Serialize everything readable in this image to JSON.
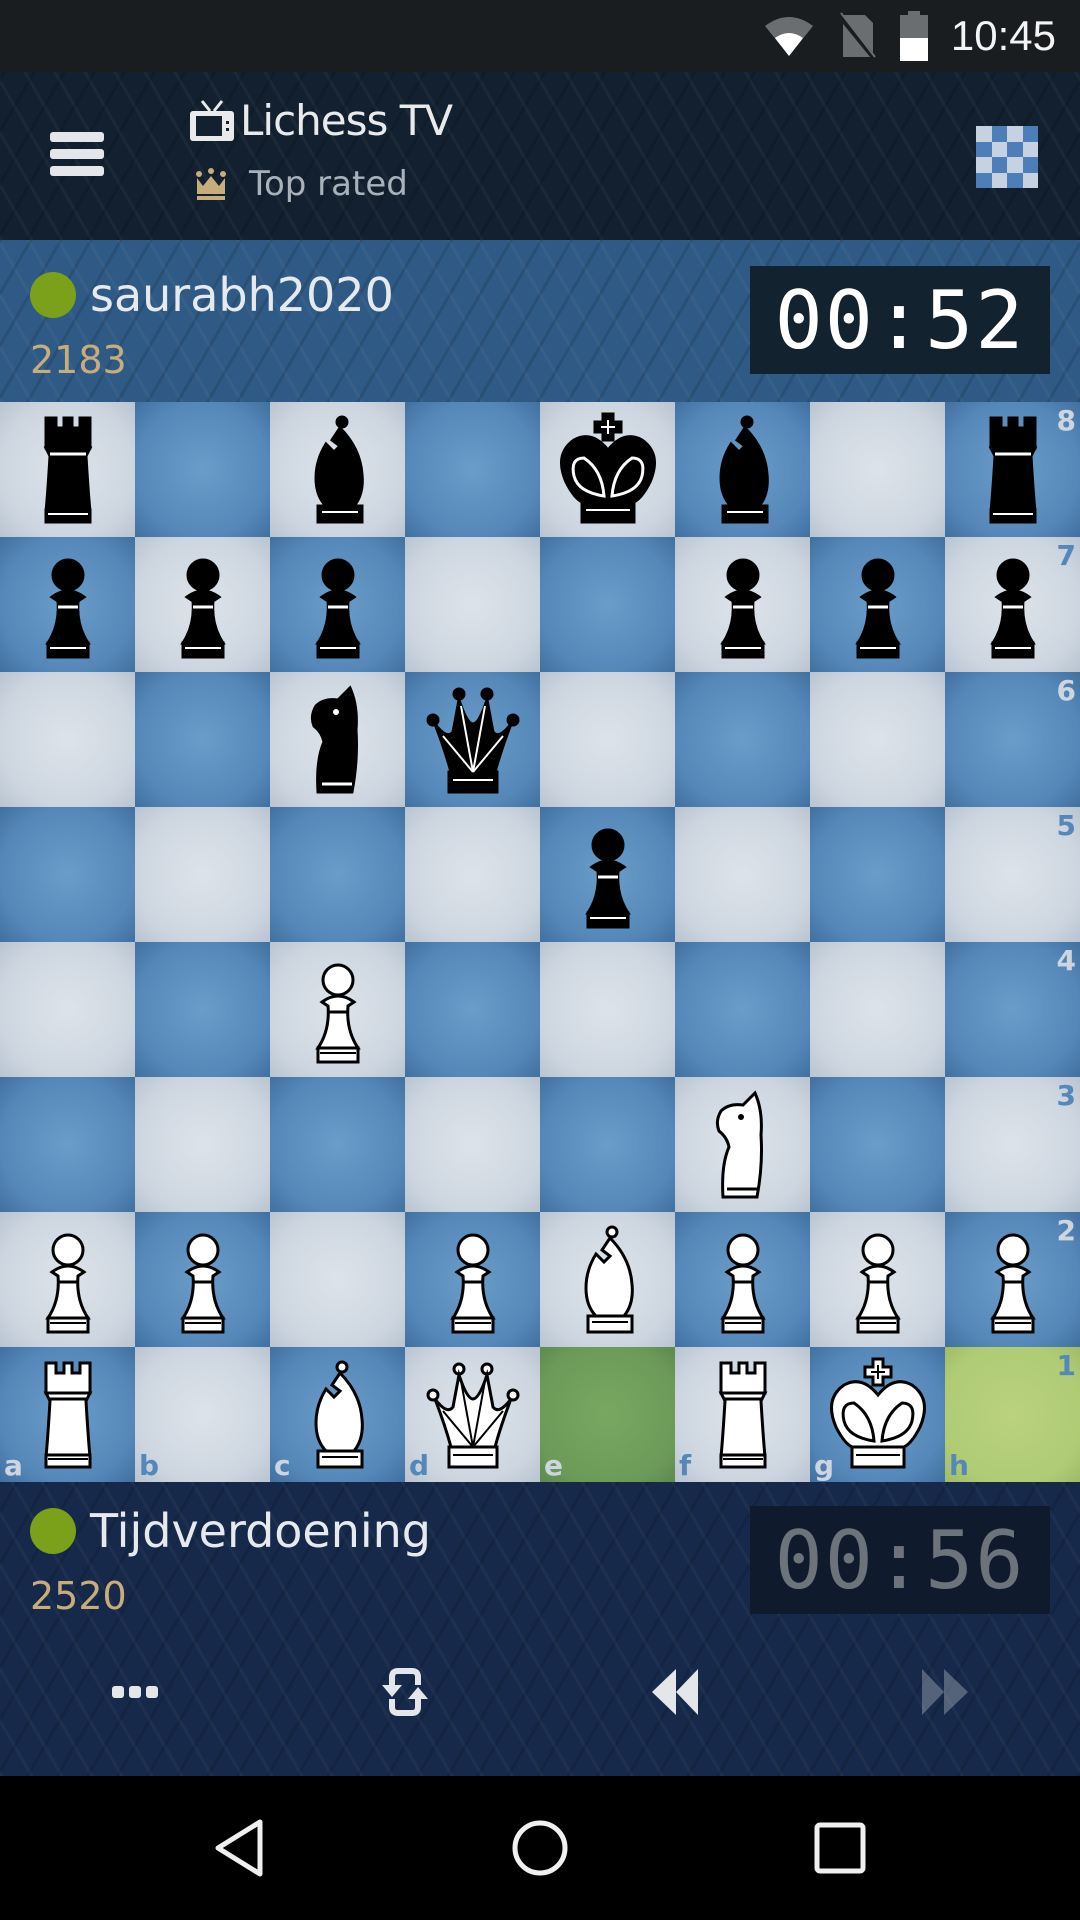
{
  "status_bar": {
    "time": "10:45",
    "icons": [
      "wifi-icon",
      "no-sim-icon",
      "battery-icon"
    ]
  },
  "header": {
    "title": "Lichess TV",
    "title_icon": "tv-icon",
    "subtitle": "Top rated",
    "subtitle_icon": "crown-icon",
    "menu_icon": "hamburger-menu-icon",
    "board_settings_icon": "checkerboard-icon"
  },
  "top_player": {
    "name": "saurabh2020",
    "rating": "2183",
    "clock": "00:52",
    "status": "online",
    "status_color": "#7ba11a",
    "clock_active": true
  },
  "bottom_player": {
    "name": "Tijdverdoening",
    "rating": "2520",
    "clock": "00:56",
    "status": "online",
    "status_color": "#7ba11a",
    "clock_active": false
  },
  "board": {
    "orientation": "white",
    "files": [
      "a",
      "b",
      "c",
      "d",
      "e",
      "f",
      "g",
      "h"
    ],
    "ranks": [
      "8",
      "7",
      "6",
      "5",
      "4",
      "3",
      "2",
      "1"
    ],
    "last_move": {
      "from": "e1",
      "to": "h1"
    },
    "colors": {
      "light": "#cdd6e0",
      "dark": "#5587b9",
      "last_move_from": "#6c9a58",
      "last_move_to": "#afcb74"
    },
    "pieces": {
      "a8": "bR",
      "c8": "bB",
      "e8": "bK",
      "f8": "bB",
      "h8": "bR",
      "a7": "bP",
      "b7": "bP",
      "c7": "bP",
      "f7": "bP",
      "g7": "bP",
      "h7": "bP",
      "c6": "bN",
      "d6": "bQ",
      "e5": "bP",
      "c4": "wP",
      "f3": "wN",
      "a2": "wP",
      "b2": "wP",
      "d2": "wP",
      "e2": "wB",
      "f2": "wP",
      "g2": "wP",
      "h2": "wP",
      "a1": "wR",
      "c1": "wB",
      "d1": "wQ",
      "f1": "wR",
      "g1": "wK"
    }
  },
  "controls": [
    {
      "name": "more-options-button",
      "icon": "ellipsis-icon",
      "enabled": true
    },
    {
      "name": "flip-board-button",
      "icon": "flip-icon",
      "enabled": true
    },
    {
      "name": "step-backward-button",
      "icon": "rewind-icon",
      "enabled": true
    },
    {
      "name": "step-forward-button",
      "icon": "fast-forward-icon",
      "enabled": false
    }
  ],
  "nav_bar": [
    {
      "name": "back-button",
      "icon": "back-triangle-icon"
    },
    {
      "name": "home-button",
      "icon": "home-circle-icon"
    },
    {
      "name": "recents-button",
      "icon": "recents-square-icon"
    }
  ]
}
